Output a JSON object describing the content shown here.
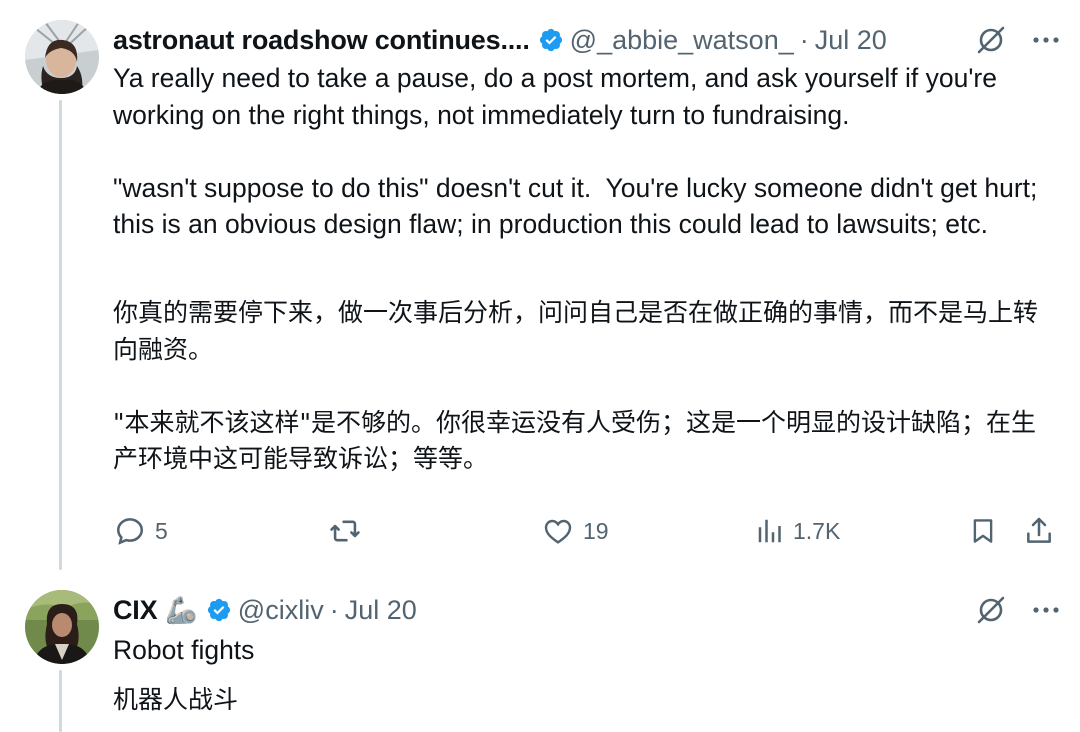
{
  "tweets": [
    {
      "name": "astronaut roadshow continues....",
      "handle": "@_abbie_watson_",
      "separator": "·",
      "date": "Jul 20",
      "text": "Ya really need to take a pause, do a post mortem, and ask yourself if you're working on the right things, not immediately turn to fundraising.\n\n\"wasn't suppose to do this\" doesn't cut it.  You're lucky someone didn't get hurt; this is an obvious design flaw; in production this could lead to lawsuits; etc.",
      "translation": "你真的需要停下来，做一次事后分析，问问自己是否在做正确的事情，而不是马上转向融资。\n\n\"本来就不该这样\"是不够的。你很幸运没有人受伤；这是一个明显的设计缺陷；在生产环境中这可能导致诉讼；等等。",
      "stats": {
        "replies": "5",
        "retweets": "",
        "likes": "19",
        "views": "1.7K"
      }
    },
    {
      "name": "CIX",
      "name_emoji": "🦾",
      "handle": "@cixliv",
      "separator": "·",
      "date": "Jul 20",
      "text": "Robot fights",
      "translation": "机器人战斗"
    }
  ],
  "icons": {
    "verified": "verified-badge-icon",
    "grok": "grok-icon",
    "more": "more-icon",
    "reply": "reply-icon",
    "retweet": "retweet-icon",
    "like": "like-icon",
    "views": "views-icon",
    "bookmark": "bookmark-icon",
    "share": "share-icon"
  },
  "colors": {
    "verified": "#1d9bf0",
    "text": "#0f1419",
    "muted": "#536471",
    "thread_line": "#cfd9de"
  }
}
